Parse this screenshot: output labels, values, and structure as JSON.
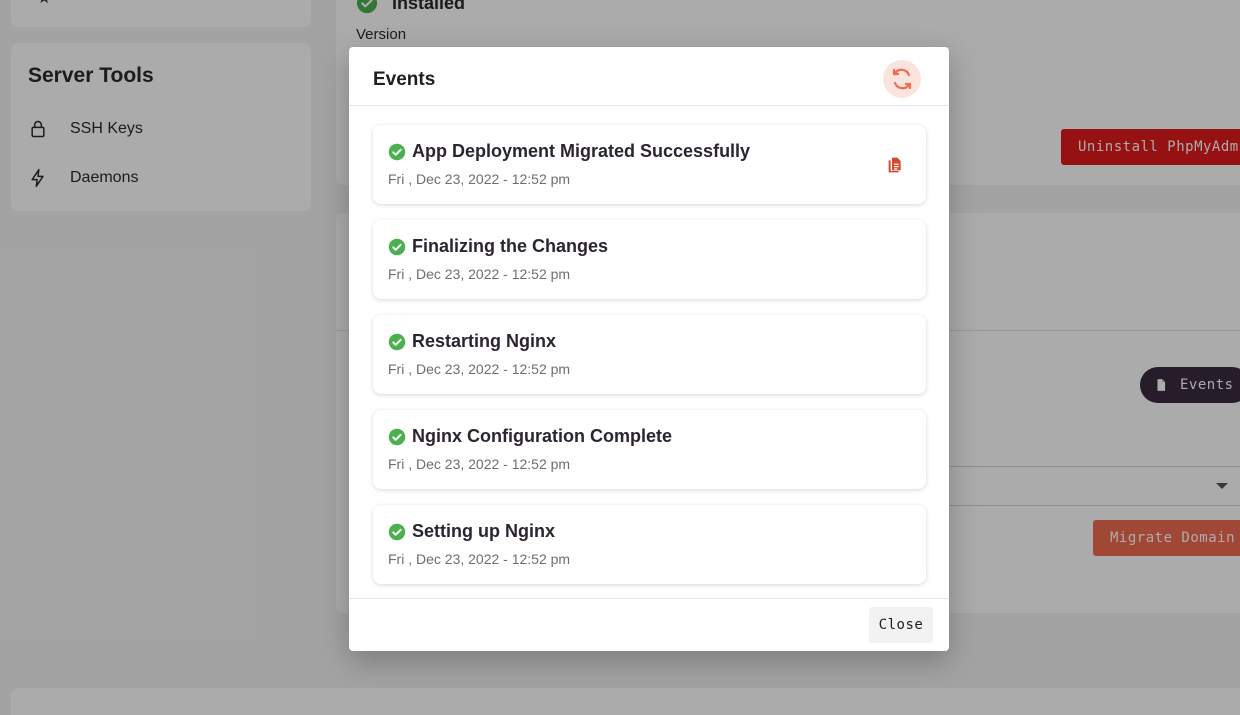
{
  "sidebar": {
    "section_title": "Server Tools",
    "items": [
      {
        "label": "SSH Keys",
        "icon": "lock-icon"
      },
      {
        "label": "Daemons",
        "icon": "bolt-icon"
      }
    ]
  },
  "main": {
    "status": "Installed",
    "version_label": "Version",
    "uninstall_button": "Uninstall PhpMyAdmin",
    "events_button": "Events",
    "migrate_button": "Migrate Domain"
  },
  "modal": {
    "title": "Events",
    "close_label": "Close",
    "events": [
      {
        "title": "App Deployment Migrated Successfully",
        "date": "Fri , Dec 23, 2022 - 12:52 pm"
      },
      {
        "title": "Finalizing the Changes",
        "date": "Fri , Dec 23, 2022 - 12:52 pm"
      },
      {
        "title": "Restarting Nginx",
        "date": "Fri , Dec 23, 2022 - 12:52 pm"
      },
      {
        "title": "Nginx Configuration Complete",
        "date": "Fri , Dec 23, 2022 - 12:52 pm"
      },
      {
        "title": "Setting up Nginx",
        "date": "Fri , Dec 23, 2022 - 12:52 pm"
      }
    ]
  },
  "colors": {
    "accent": "#f16b4f",
    "danger": "#e01b1b",
    "success": "#4caf50",
    "dark_pill": "#3b2a3e"
  }
}
